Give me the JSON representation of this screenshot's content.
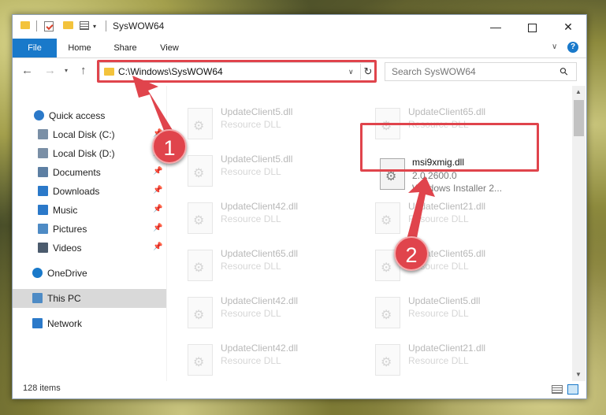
{
  "window": {
    "title": "SysWOW64",
    "min_glyph": "—",
    "close_glyph": "✕"
  },
  "quick_access_toolbar": {
    "dropdown_glyph": "▾"
  },
  "ribbon": {
    "tabs": [
      {
        "label": "File",
        "active": true
      },
      {
        "label": "Home"
      },
      {
        "label": "Share"
      },
      {
        "label": "View"
      }
    ],
    "expand_glyph": "∨",
    "help_glyph": "?"
  },
  "navigation": {
    "back_glyph": "←",
    "forward_glyph": "→",
    "recent_glyph": "▾",
    "up_glyph": "↑"
  },
  "address": {
    "path": "C:\\Windows\\SysWOW64",
    "dropdown_glyph": "∨",
    "refresh_glyph": "↻"
  },
  "search": {
    "placeholder": "Search SysWOW64",
    "icon_glyph": "⚲"
  },
  "sidebar": {
    "pin_glyph": "📌",
    "items": [
      {
        "label": "Quick access",
        "icon": "star-icon",
        "color": "#2b79c9"
      },
      {
        "label": "Local Disk (C:)",
        "icon": "drive-icon",
        "color": "#7a8fa6",
        "pinned": true
      },
      {
        "label": "Local Disk (D:)",
        "icon": "drive-icon",
        "color": "#7a8fa6",
        "pinned": true
      },
      {
        "label": "Documents",
        "icon": "documents-icon",
        "color": "#5d7fa3",
        "pinned": true
      },
      {
        "label": "Downloads",
        "icon": "download-icon",
        "color": "#2b79c9",
        "pinned": true
      },
      {
        "label": "Music",
        "icon": "music-icon",
        "color": "#2b79c9",
        "pinned": true
      },
      {
        "label": "Pictures",
        "icon": "pictures-icon",
        "color": "#4e8bc5",
        "pinned": true
      },
      {
        "label": "Videos",
        "icon": "videos-icon",
        "color": "#4b5b6d",
        "pinned": true
      },
      {
        "label": "OneDrive",
        "icon": "onedrive-icon",
        "color": "#1979ca"
      },
      {
        "label": "This PC",
        "icon": "computer-icon",
        "color": "#4e8bc5",
        "selected": true
      },
      {
        "label": "Network",
        "icon": "network-icon",
        "color": "#2b79c9"
      }
    ]
  },
  "files": {
    "faded_tiles": [
      {
        "name": "UpdateClient5.dll",
        "desc": "Resource DLL"
      },
      {
        "name": "UpdateClient65.dll",
        "desc": "Resource DLL"
      },
      {
        "name": "UpdateClient5.dll",
        "desc": "Resource DLL"
      },
      {
        "name": "UpdateClient42.dll",
        "desc": "Resource DLL"
      },
      {
        "name": "UpdateClient21.dll",
        "desc": "Resource DLL"
      },
      {
        "name": "UpdateClient65.dll",
        "desc": "Resource DLL"
      },
      {
        "name": "UpdateClient65.dll",
        "desc": "Resource DLL"
      },
      {
        "name": "UpdateClient42.dll",
        "desc": "Resource DLL"
      },
      {
        "name": "UpdateClient5.dll",
        "desc": "Resource DLL"
      },
      {
        "name": "UpdateClient42.dll",
        "desc": "Resource DLL"
      },
      {
        "name": "UpdateClient21.dll",
        "desc": "Resource DLL"
      },
      {
        "name": "UpdateClient42.dll",
        "desc": "Resource DLL"
      }
    ],
    "highlighted": {
      "name": "msi9xmig.dll",
      "version": "2.0.2600.0",
      "description": "Windows Installer 2..."
    }
  },
  "status": {
    "item_count": "128 items"
  },
  "scrollbar": {
    "up_glyph": "▲",
    "down_glyph": "▼"
  },
  "annotations": {
    "badge_1": "1",
    "badge_2": "2",
    "color": "#e0444c"
  }
}
